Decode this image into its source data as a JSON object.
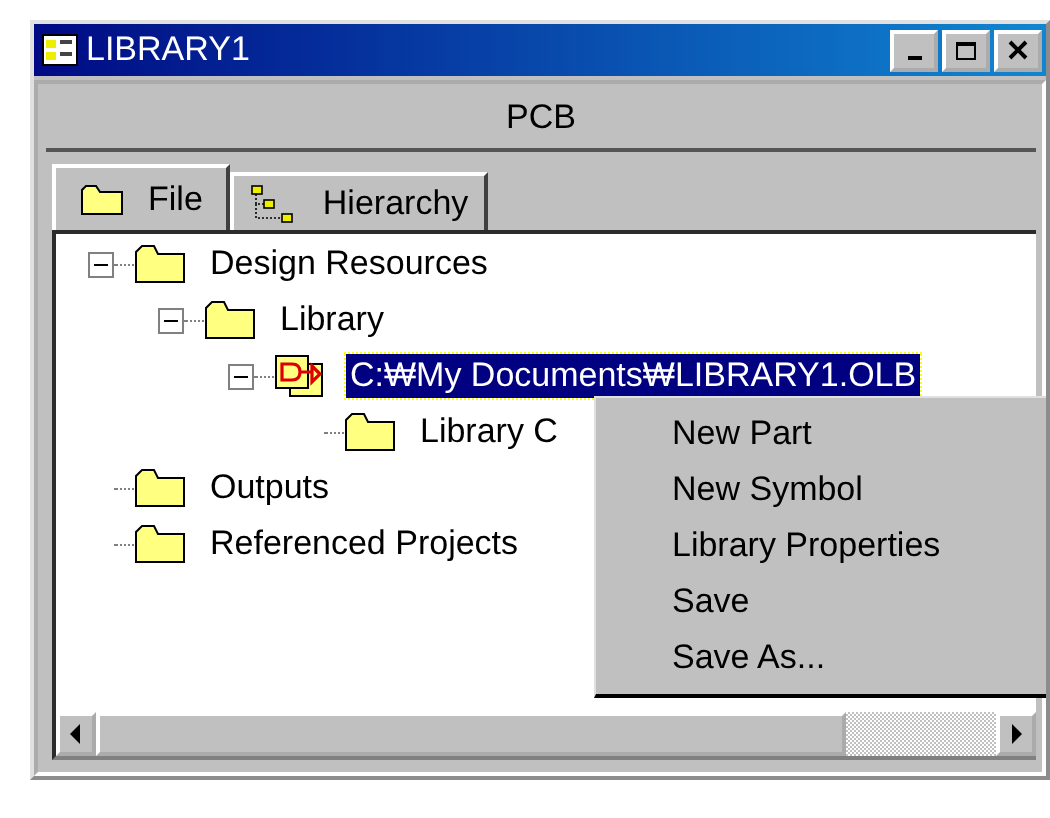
{
  "window": {
    "title": "LIBRARY1"
  },
  "header": {
    "title": "PCB"
  },
  "tabs": [
    {
      "label": "File",
      "kind": "folder",
      "selected": true
    },
    {
      "label": "Hierarchy",
      "kind": "hierarchy",
      "selected": false
    }
  ],
  "tree": [
    {
      "label": "Design Resources",
      "kind": "folder",
      "expanded": true,
      "selected": false,
      "children": [
        {
          "label": "Library",
          "kind": "folder",
          "expanded": true,
          "selected": false,
          "children": [
            {
              "label": "C:₩My Documents₩LIBRARY1.OLB",
              "kind": "library",
              "expanded": true,
              "selected": true,
              "children": [
                {
                  "label": "Library C",
                  "kind": "folder",
                  "selected": false
                }
              ]
            }
          ]
        }
      ]
    },
    {
      "label": "Outputs",
      "kind": "folder",
      "selected": false
    },
    {
      "label": "Referenced Projects",
      "kind": "folder",
      "selected": false
    }
  ],
  "context_menu": {
    "items": [
      "New Part",
      "New Symbol",
      "Library Properties",
      "Save",
      "Save As..."
    ]
  }
}
